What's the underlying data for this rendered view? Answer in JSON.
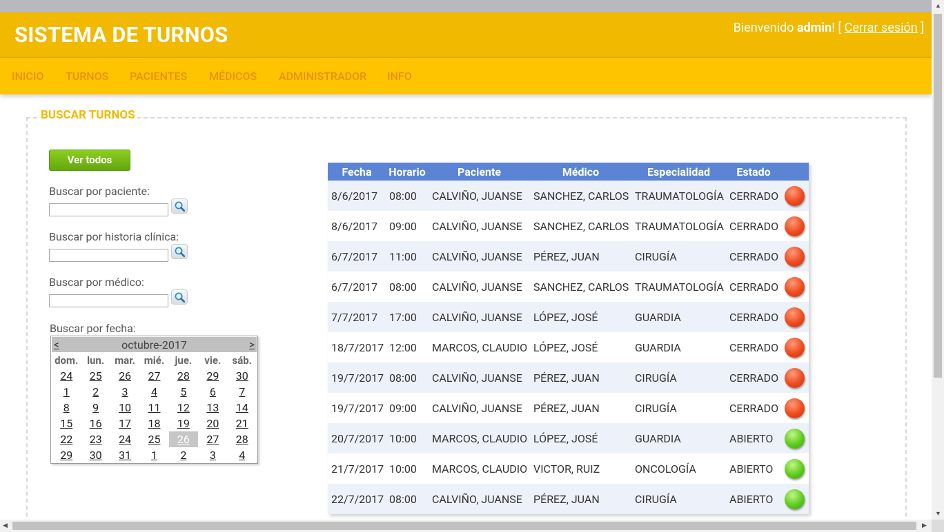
{
  "header": {
    "title": "SISTEMA DE TURNOS",
    "welcome_prefix": "Bienvenido ",
    "username": "admin",
    "welcome_bracket_open": "! [ ",
    "logout_label": "Cerrar sesión",
    "welcome_bracket_close": " ]"
  },
  "nav": {
    "items": [
      {
        "label": "INICIO"
      },
      {
        "label": "TURNOS"
      },
      {
        "label": "PACIENTES"
      },
      {
        "label": "MÉDICOS"
      },
      {
        "label": "ADMINISTRADOR"
      },
      {
        "label": "INFO"
      }
    ]
  },
  "search": {
    "legend": "BUSCAR TURNOS",
    "ver_todos_label": "Ver todos",
    "paciente_label": "Buscar por paciente:",
    "historia_label": "Buscar por historia clínica:",
    "medico_label": "Buscar por médico:",
    "fecha_label": "Buscar por fecha:",
    "paciente_value": "",
    "historia_value": "",
    "medico_value": ""
  },
  "calendar": {
    "prev": "<",
    "next": ">",
    "month": "octubre-2017",
    "weekdays": [
      "dom.",
      "lun.",
      "mar.",
      "mié.",
      "jue.",
      "vie.",
      "sáb."
    ],
    "weeks": [
      [
        "24",
        "25",
        "26",
        "27",
        "28",
        "29",
        "30"
      ],
      [
        "1",
        "2",
        "3",
        "4",
        "5",
        "6",
        "7"
      ],
      [
        "8",
        "9",
        "10",
        "11",
        "12",
        "13",
        "14"
      ],
      [
        "15",
        "16",
        "17",
        "18",
        "19",
        "20",
        "21"
      ],
      [
        "22",
        "23",
        "24",
        "25",
        "26",
        "27",
        "28"
      ],
      [
        "29",
        "30",
        "31",
        "1",
        "2",
        "3",
        "4"
      ]
    ],
    "selected_day": "26"
  },
  "table": {
    "headers": [
      "Fecha",
      "Horario",
      "Paciente",
      "Médico",
      "Especialidad",
      "Estado",
      ""
    ],
    "rows": [
      {
        "fecha": "8/6/2017",
        "horario": "08:00",
        "paciente": "CALVIÑO, JUANSE",
        "medico": "SANCHEZ, CARLOS",
        "especialidad": "TRAUMATOLOGÍA",
        "estado": "CERRADO",
        "indicator": "red"
      },
      {
        "fecha": "8/6/2017",
        "horario": "09:00",
        "paciente": "CALVIÑO, JUANSE",
        "medico": "SANCHEZ, CARLOS",
        "especialidad": "TRAUMATOLOGÍA",
        "estado": "CERRADO",
        "indicator": "red"
      },
      {
        "fecha": "6/7/2017",
        "horario": "11:00",
        "paciente": "CALVIÑO, JUANSE",
        "medico": "PÉREZ, JUAN",
        "especialidad": "CIRUGÍA",
        "estado": "CERRADO",
        "indicator": "red"
      },
      {
        "fecha": "6/7/2017",
        "horario": "08:00",
        "paciente": "CALVIÑO, JUANSE",
        "medico": "SANCHEZ, CARLOS",
        "especialidad": "TRAUMATOLOGÍA",
        "estado": "CERRADO",
        "indicator": "red"
      },
      {
        "fecha": "7/7/2017",
        "horario": "17:00",
        "paciente": "CALVIÑO, JUANSE",
        "medico": "LÓPEZ, JOSÉ",
        "especialidad": "GUARDIA",
        "estado": "CERRADO",
        "indicator": "red"
      },
      {
        "fecha": "18/7/2017",
        "horario": "12:00",
        "paciente": "MARCOS, CLAUDIO",
        "medico": "LÓPEZ, JOSÉ",
        "especialidad": "GUARDIA",
        "estado": "CERRADO",
        "indicator": "red"
      },
      {
        "fecha": "19/7/2017",
        "horario": "08:00",
        "paciente": "CALVIÑO, JUANSE",
        "medico": "PÉREZ, JUAN",
        "especialidad": "CIRUGÍA",
        "estado": "CERRADO",
        "indicator": "red"
      },
      {
        "fecha": "19/7/2017",
        "horario": "09:00",
        "paciente": "CALVIÑO, JUANSE",
        "medico": "PÉREZ, JUAN",
        "especialidad": "CIRUGÍA",
        "estado": "CERRADO",
        "indicator": "red"
      },
      {
        "fecha": "20/7/2017",
        "horario": "10:00",
        "paciente": "MARCOS, CLAUDIO",
        "medico": "LÓPEZ, JOSÉ",
        "especialidad": "GUARDIA",
        "estado": "ABIERTO",
        "indicator": "green"
      },
      {
        "fecha": "21/7/2017",
        "horario": "10:00",
        "paciente": "MARCOS, CLAUDIO",
        "medico": "VICTOR, RUIZ",
        "especialidad": "ONCOLOGÍA",
        "estado": "ABIERTO",
        "indicator": "green"
      },
      {
        "fecha": "22/7/2017",
        "horario": "08:00",
        "paciente": "CALVIÑO, JUANSE",
        "medico": "PÉREZ, JUAN",
        "especialidad": "CIRUGÍA",
        "estado": "ABIERTO",
        "indicator": "green"
      }
    ]
  },
  "colors": {
    "topbar": "#f1b900",
    "navbar": "#ffc400",
    "nav_text": "#e8900d",
    "table_header": "#5b84d4",
    "closed": "#ee4a1d",
    "open": "#5ecb1c"
  }
}
